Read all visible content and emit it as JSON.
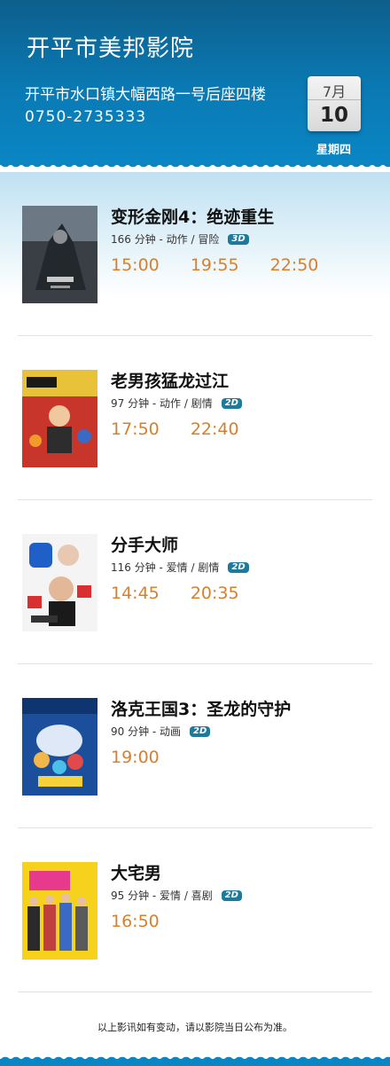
{
  "cinema": {
    "name": "开平市美邦影院",
    "address": "开平市水口镇大幅西路一号后座四楼",
    "phone": "0750-2735333"
  },
  "date": {
    "month": "7月",
    "day": "10",
    "weekday": "星期四"
  },
  "movies": [
    {
      "title": "变形金刚4：绝迹重生",
      "meta": "166 分钟 - 动作 / 冒险",
      "format": "3D",
      "times": [
        "15:00",
        "19:55",
        "22:50"
      ]
    },
    {
      "title": "老男孩猛龙过江",
      "meta": "97  分钟 - 动作 / 剧情",
      "format": "2D",
      "times": [
        "17:50",
        "22:40"
      ]
    },
    {
      "title": "分手大师",
      "meta": "116  分钟 - 爱情 / 剧情",
      "format": "2D",
      "times": [
        "14:45",
        "20:35"
      ]
    },
    {
      "title": "洛克王国3：圣龙的守护",
      "meta": "90  分钟 - 动画",
      "format": "2D",
      "times": [
        "19:00"
      ]
    },
    {
      "title": "大宅男",
      "meta": "95  分钟 - 爱情 / 喜剧",
      "format": "2D",
      "times": [
        "16:50"
      ]
    }
  ],
  "footer": {
    "note": "以上影讯如有变动，请以影院当日公布为准。"
  },
  "colors": {
    "header": "#0a7ab4",
    "showtime": "#d5802f",
    "badge": "#1e7a9c"
  }
}
